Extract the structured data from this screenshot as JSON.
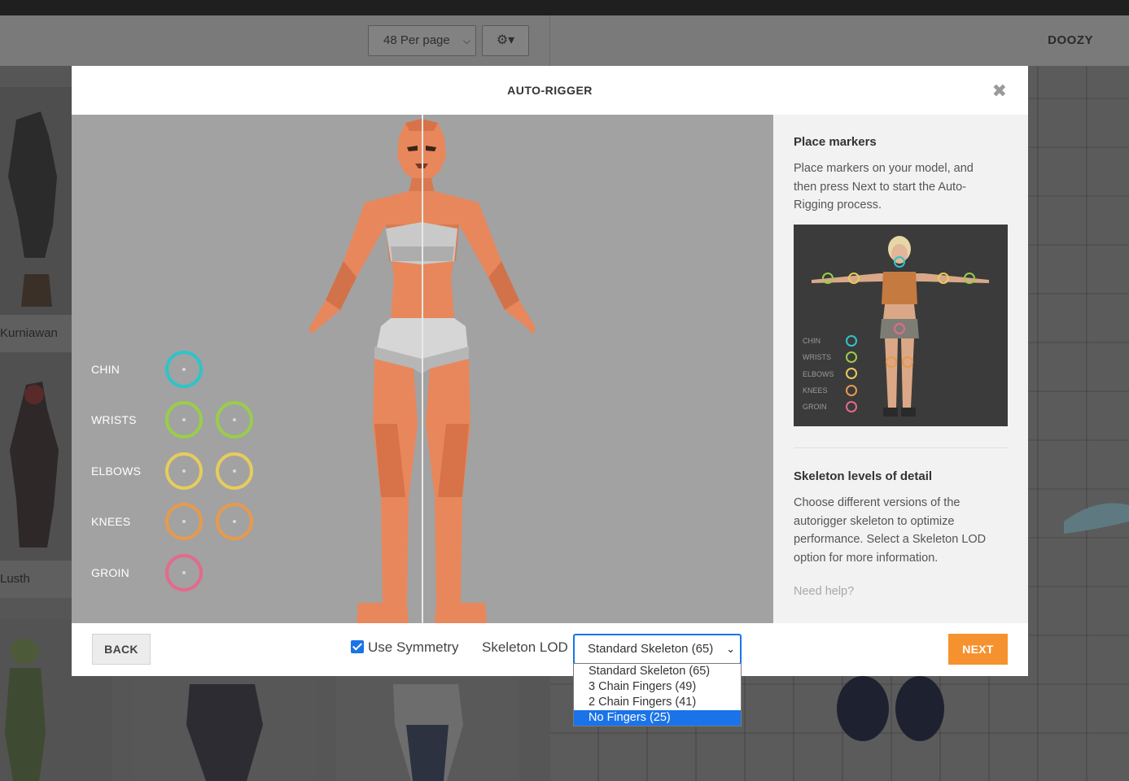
{
  "app": {
    "per_page_value": "48 Per page",
    "brand": "DOOZY",
    "background_cards": [
      {
        "label": "Kurniawan"
      },
      {
        "label": "Lusth"
      }
    ]
  },
  "modal": {
    "title": "AUTO-RIGGER",
    "close_icon": "close-icon",
    "markers": [
      {
        "label": "CHIN",
        "color": "#2ec4c9",
        "count": 1
      },
      {
        "label": "WRISTS",
        "color": "#9acd4b",
        "count": 2
      },
      {
        "label": "ELBOWS",
        "color": "#e6cc5c",
        "count": 2
      },
      {
        "label": "KNEES",
        "color": "#e79a4d",
        "count": 2
      },
      {
        "label": "GROIN",
        "color": "#e36a8c",
        "count": 1
      }
    ],
    "side_panel": {
      "place_heading": "Place markers",
      "place_text": "Place markers on your model, and then press Next to start the Auto-Rigging process.",
      "reference_labels": [
        "CHIN",
        "WRISTS",
        "ELBOWS",
        "KNEES",
        "GROIN"
      ],
      "lod_heading": "Skeleton levels of detail",
      "lod_text": "Choose different versions of the autorigger skeleton to optimize performance. Select a Skeleton LOD option for more information.",
      "help_link": "Need help?"
    },
    "footer": {
      "back_label": "BACK",
      "symmetry_label": "Use Symmetry",
      "symmetry_checked": true,
      "lod_label": "Skeleton LOD",
      "lod_selected": "Standard Skeleton (65)",
      "lod_options": [
        "Standard Skeleton (65)",
        "3 Chain Fingers (49)",
        "2 Chain Fingers (41)",
        "No Fingers (25)"
      ],
      "lod_highlighted": "No Fingers (25)",
      "next_label": "NEXT"
    }
  },
  "colors": {
    "accent": "#1a73e8",
    "next_button": "#f5922f",
    "skin": "#e8875c"
  }
}
